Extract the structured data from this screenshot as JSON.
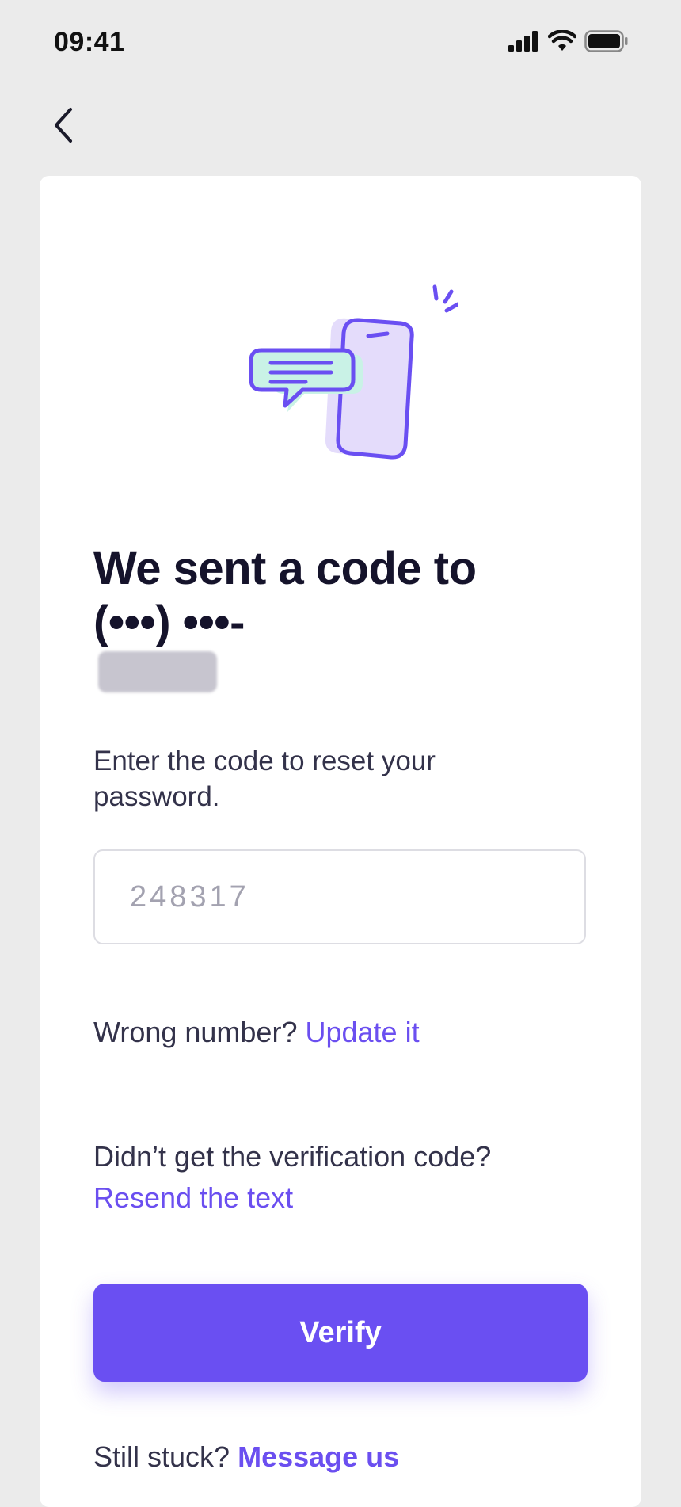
{
  "status_bar": {
    "time": "09:41"
  },
  "nav": {
    "back_icon": "chevron-left-icon"
  },
  "illustration": {
    "icon": "phone-message-illustration",
    "colors": {
      "stroke": "#6a4ff2",
      "phone_fill": "#e4dcfb",
      "bubble_fill": "#c9f2e6"
    }
  },
  "header": {
    "title_line1": "We sent a code to",
    "title_line2": "(•••) •••-"
  },
  "body": {
    "subtitle": "Enter the code to reset your password."
  },
  "code_field": {
    "placeholder": "248317",
    "value": ""
  },
  "wrong_number": {
    "prompt": "Wrong number?",
    "link": "Update it"
  },
  "resend": {
    "prompt": "Didn’t get the verification code?",
    "link": "Resend the text"
  },
  "verify_button": {
    "label": "Verify"
  },
  "help": {
    "prompt": "Still stuck?",
    "link": "Message us"
  },
  "colors": {
    "accent": "#6a4ff2",
    "background": "#ebebeb",
    "card": "#ffffff"
  }
}
